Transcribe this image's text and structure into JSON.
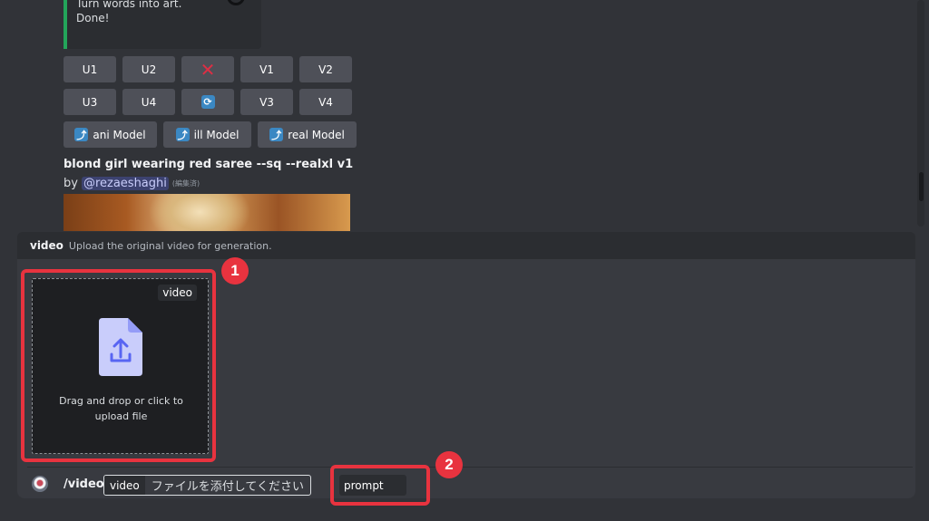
{
  "embed": {
    "line1": "Turn words into art.",
    "line2": "Done!"
  },
  "buttons": {
    "row1": [
      "U1",
      "U2",
      "",
      "V1",
      "V2"
    ],
    "row2": [
      "U3",
      "U4",
      "",
      "V3",
      "V4"
    ],
    "models": [
      "ani Model",
      "ill Model",
      "real Model"
    ],
    "delete_icon": "x-mark-icon",
    "reroll_icon": "refresh-icon",
    "model_icon": "up-arrow-icon"
  },
  "message": {
    "title": "blond girl wearing red saree --sq --realxl v1",
    "by": "by",
    "mention": "@rezaeshaghi",
    "edited": "(編集済)"
  },
  "command": {
    "name": "video",
    "description": "Upload the original video for generation."
  },
  "upload": {
    "tag": "video",
    "text": "Drag and drop or click to upload file",
    "icon": "file-upload-icon"
  },
  "input": {
    "slash": "/video",
    "option1_name": "video",
    "option1_value": "ファイルを添付してください",
    "option2_name": "prompt"
  },
  "annotations": {
    "badge1": "1",
    "badge2": "2"
  },
  "colors": {
    "background": "#313338",
    "button": "#4e5058",
    "accent_green": "#23a55a",
    "callout_red": "#e8333f",
    "mention_bg": "#3c4270"
  }
}
